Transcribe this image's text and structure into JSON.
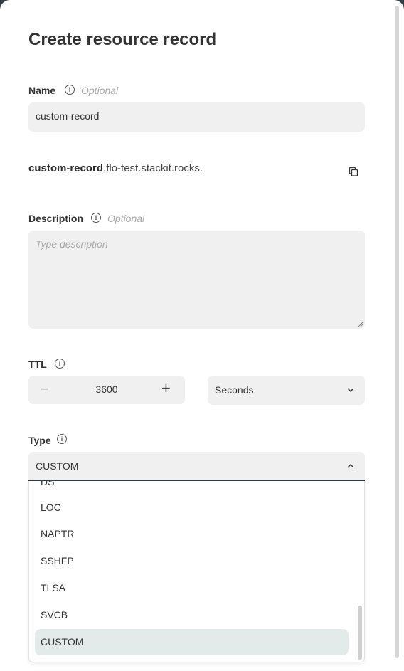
{
  "dialog": {
    "title": "Create resource record",
    "name": {
      "label": "Name",
      "optional": "Optional",
      "value": "custom-record",
      "fqdn_prefix": "custom-record",
      "fqdn_suffix": ".flo-test.stackit.rocks."
    },
    "description": {
      "label": "Description",
      "optional": "Optional",
      "placeholder": "Type description"
    },
    "ttl": {
      "label": "TTL",
      "minus": "−",
      "value": "3600",
      "plus": "+",
      "unit": "Seconds"
    },
    "type": {
      "label": "Type",
      "value": "CUSTOM",
      "options": [
        "DS",
        "LOC",
        "NAPTR",
        "SSHFP",
        "TLSA",
        "SVCB",
        "CUSTOM"
      ]
    }
  },
  "icons": {
    "info": "info-icon",
    "copy": "copy-icon",
    "chevron_down": "chevron-down-icon",
    "chevron_up": "chevron-up-icon"
  },
  "colors": {
    "accent": "#2a3f4a",
    "field_bg": "#f0f0f0",
    "selected_bg": "#e3eaea"
  }
}
